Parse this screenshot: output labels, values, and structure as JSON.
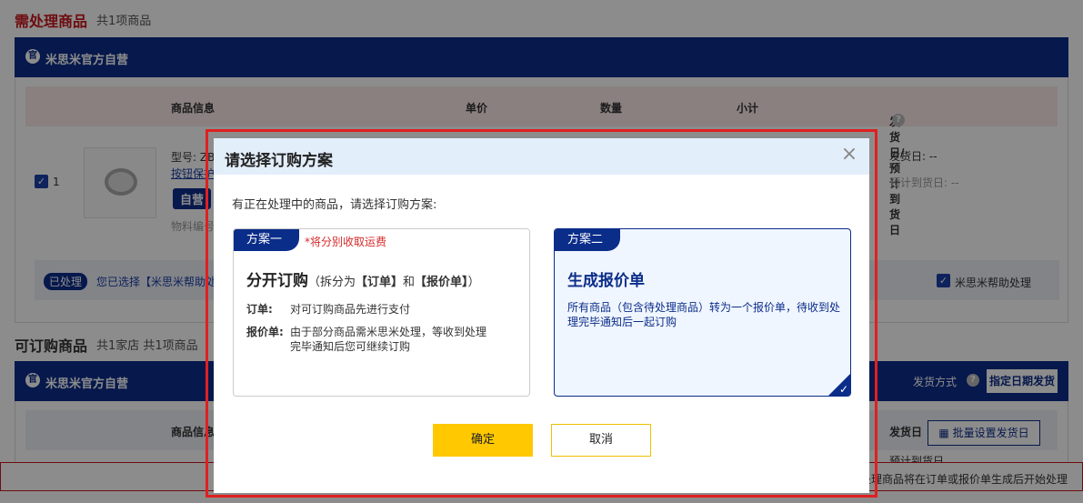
{
  "section1": {
    "title": "需处理商品",
    "count": "共1项商品"
  },
  "section2": {
    "title": "可订购商品",
    "count": "共1家店  共1项商品"
  },
  "shop": {
    "name": "米思米官方自营",
    "logo": "官"
  },
  "table": {
    "headers": [
      "商品信息",
      "单价",
      "数量",
      "小计",
      "发货日/预计到货日"
    ],
    "help": "?"
  },
  "product": {
    "index": "1",
    "model": "型号: ZB",
    "link": "按钮保护",
    "tag": "自营",
    "material": "物料编号",
    "ship_day": "发货日: --",
    "arrive_day": "预计到货日: --"
  },
  "status": {
    "pill": "已处理",
    "text": "您已选择【米思米帮助处",
    "assist_label": "米思米帮助处理"
  },
  "shipping": {
    "mode_label": "发货方式",
    "mode_button": "指定日期发货",
    "ship_label": "发货日",
    "batch_button": "批量设置发货日",
    "arrive_label": "预计到货日"
  },
  "bottom": {
    "note": "处理商品将在订单或报价单生成后开始处理"
  },
  "dialog": {
    "title": "请选择订购方案",
    "close": "×",
    "intro": "有正在处理中的商品，请选择订购方案:",
    "plan1": {
      "tag": "方案一",
      "warning": "*将分别收取运费",
      "title": "分开订购",
      "subtitle_prefix": "（拆分为",
      "subtitle_order": "【订单】",
      "subtitle_and": "和",
      "subtitle_quote": "【报价单】",
      "subtitle_suffix": "）",
      "row1_label": "订单:",
      "row1_value": "对可订购商品先进行支付",
      "row2_label": "报价单:",
      "row2_value": "由于部分商品需米思米处理，等收到处理完毕通知后您可继续订购"
    },
    "plan2": {
      "tag": "方案二",
      "title": "生成报价单",
      "desc": "所有商品（包含待处理商品）转为一个报价单，待收到处理完毕通知后一起订购",
      "selected_mark": "✓"
    },
    "ok": "确定",
    "cancel": "取消"
  },
  "colors": {
    "brand_blue": "#0b2d8a",
    "accent_red": "#c8161d",
    "confirm_yellow": "#ffc800"
  }
}
